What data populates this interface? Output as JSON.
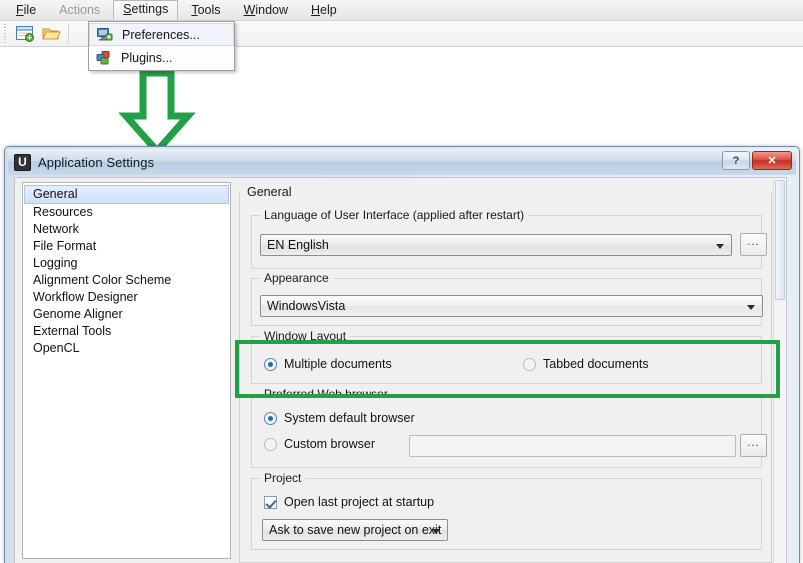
{
  "menubar": {
    "items": [
      {
        "label": "File",
        "state": "enabled"
      },
      {
        "label": "Actions",
        "state": "disabled"
      },
      {
        "label": "Settings",
        "state": "open"
      },
      {
        "label": "Tools",
        "state": "enabled"
      },
      {
        "label": "Window",
        "state": "enabled"
      },
      {
        "label": "Help",
        "state": "enabled"
      }
    ]
  },
  "toolbar": {
    "buttons": [
      {
        "name": "new-document-icon",
        "tooltip": "New document"
      },
      {
        "name": "open-folder-icon",
        "tooltip": "Open"
      }
    ]
  },
  "settings_menu": {
    "items": [
      {
        "label": "Preferences...",
        "icon": "preferences-monitor-icon",
        "hovered": true
      },
      {
        "label": "Plugins...",
        "icon": "plugins-blocks-icon",
        "hovered": false
      }
    ]
  },
  "annotation": {
    "arrow_color": "#22a046",
    "highlight_color": "#22a046",
    "highlight_target": "Window Layout"
  },
  "dialog": {
    "title": "Application Settings",
    "app_icon_letter": "U",
    "window_buttons": {
      "help_label": "?",
      "close_label": "✕"
    },
    "sidebar": {
      "items": [
        {
          "label": "General",
          "selected": true
        },
        {
          "label": "Resources",
          "selected": false
        },
        {
          "label": "Network",
          "selected": false
        },
        {
          "label": "File Format",
          "selected": false
        },
        {
          "label": "Logging",
          "selected": false
        },
        {
          "label": "Alignment Color Scheme",
          "selected": false
        },
        {
          "label": "Workflow Designer",
          "selected": false
        },
        {
          "label": "Genome Aligner",
          "selected": false
        },
        {
          "label": "External Tools",
          "selected": false
        },
        {
          "label": "OpenCL",
          "selected": false
        }
      ]
    },
    "content": {
      "title": "General",
      "language_group": {
        "title": "Language of User Interface (applied after restart)",
        "combo_value": "EN English",
        "browse_label": "..."
      },
      "appearance_group": {
        "title": "Appearance",
        "combo_value": "WindowsVista"
      },
      "window_layout_group": {
        "title": "Window Layout",
        "options": [
          {
            "label": "Multiple documents",
            "selected": true
          },
          {
            "label": "Tabbed documents",
            "selected": false
          }
        ]
      },
      "web_browser_group": {
        "title": "Preferred Web browser",
        "options": [
          {
            "label": "System default browser",
            "selected": true
          },
          {
            "label": "Custom browser",
            "selected": false
          }
        ],
        "custom_browser_value": "",
        "browse_label": "..."
      },
      "project_group": {
        "title": "Project",
        "checkbox": {
          "label": "Open last project at startup",
          "checked": true
        },
        "combo_value": "Ask to save new project on exit"
      }
    }
  }
}
